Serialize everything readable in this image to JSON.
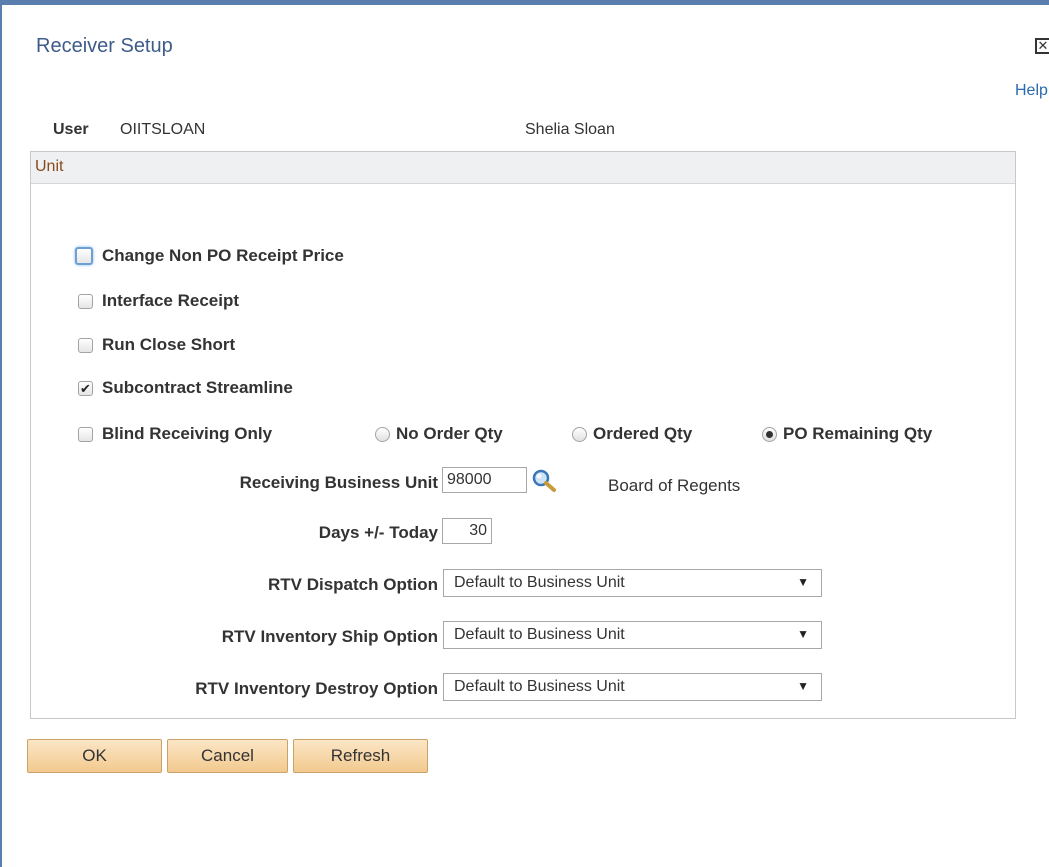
{
  "modal": {
    "title": "Receiver Setup",
    "close_symbol": "✕",
    "help_label": "Help"
  },
  "user": {
    "label": "User",
    "id": "OIITSLOAN",
    "name": "Shelia Sloan"
  },
  "unit_section": {
    "header": "Unit",
    "checkboxes": [
      {
        "label": "Change Non PO Receipt Price",
        "checked": false
      },
      {
        "label": "Interface Receipt",
        "checked": false
      },
      {
        "label": "Run Close Short",
        "checked": false
      },
      {
        "label": "Subcontract Streamline",
        "checked": true
      },
      {
        "label": "Blind Receiving Only",
        "checked": false
      }
    ],
    "check_mark": "✔",
    "radios": [
      {
        "label": "No Order Qty",
        "selected": false
      },
      {
        "label": "Ordered Qty",
        "selected": false
      },
      {
        "label": "PO Remaining Qty",
        "selected": true
      }
    ],
    "receiving_bu": {
      "label": "Receiving Business Unit",
      "value": "98000",
      "description": "Board of Regents"
    },
    "days_today": {
      "label": "Days +/- Today",
      "value": "30"
    },
    "rtv_dispatch": {
      "label": "RTV Dispatch Option",
      "value": "Default to Business Unit"
    },
    "rtv_ship": {
      "label": "RTV Inventory Ship Option",
      "value": "Default to Business Unit"
    },
    "rtv_destroy": {
      "label": "RTV Inventory Destroy Option",
      "value": "Default to Business Unit"
    },
    "dropdown_arrow": "▼"
  },
  "buttons": {
    "ok": "OK",
    "cancel": "Cancel",
    "refresh": "Refresh"
  },
  "colors": {
    "title": "#3e5c89",
    "section_header_text": "#8a4a1a",
    "button_bg": "#f2c98e",
    "border_accent": "#5a7fae"
  }
}
